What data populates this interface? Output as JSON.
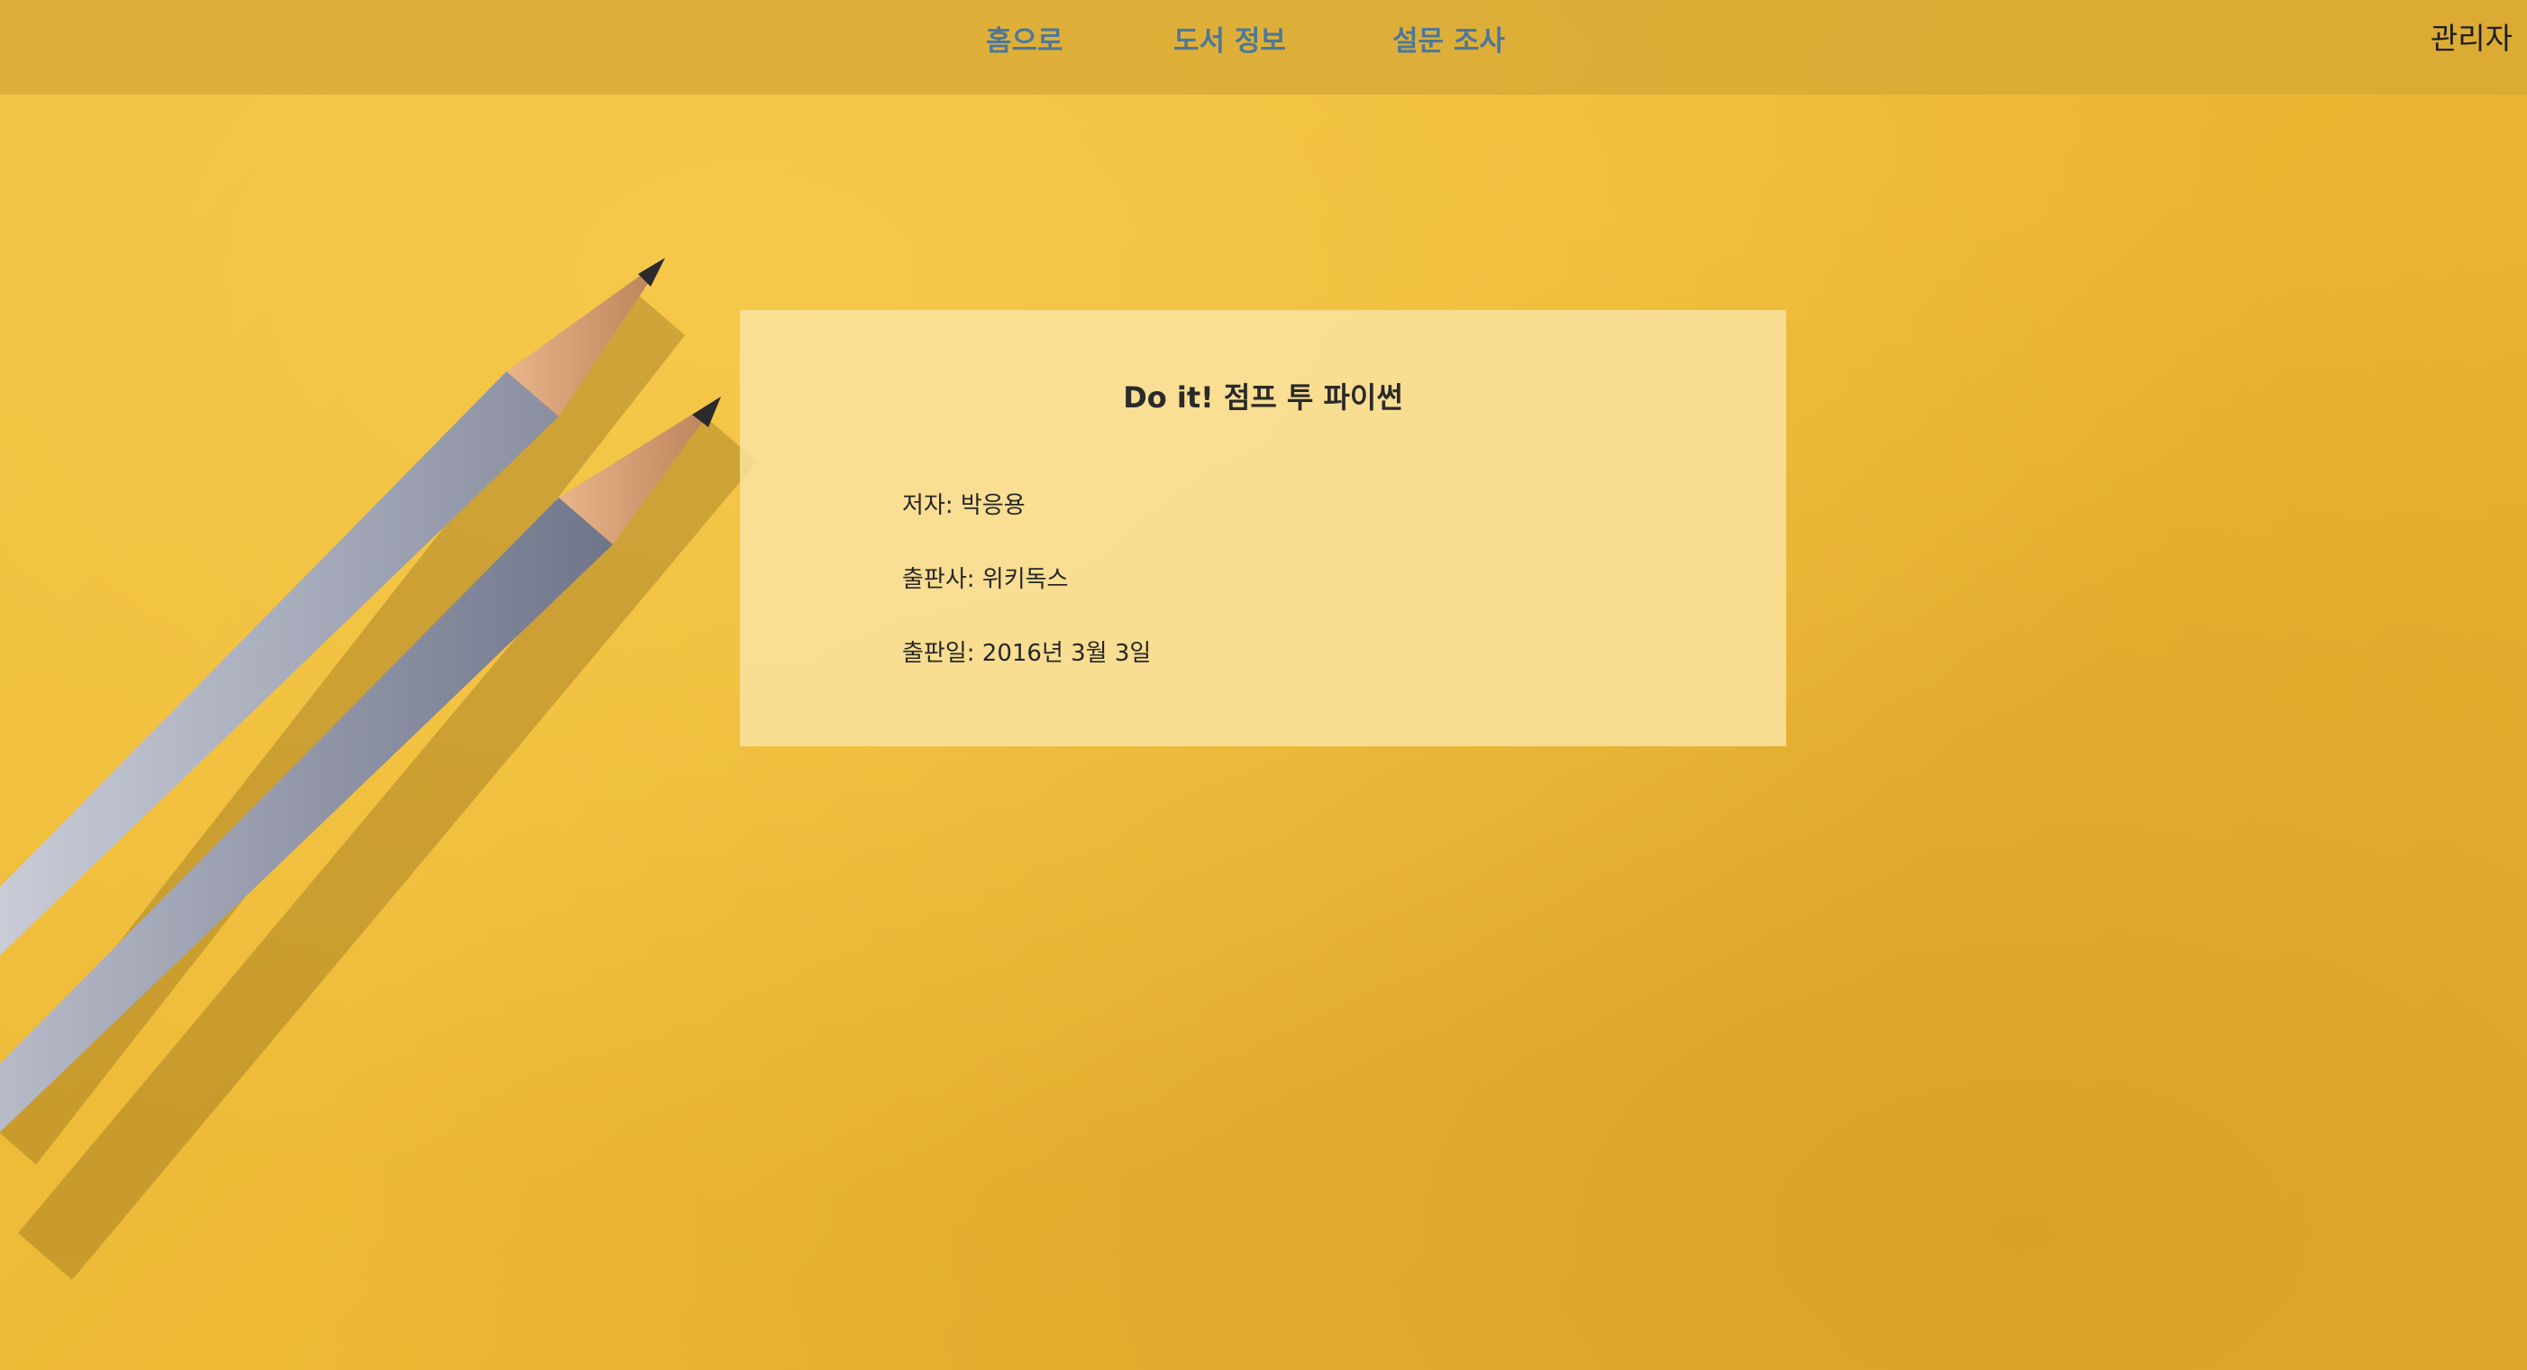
{
  "nav": {
    "home_label": "홈으로",
    "books_label": "도서 정보",
    "survey_label": "설문 조사",
    "admin_label": "관리자"
  },
  "book": {
    "title": "Do it! 점프 투 파이썬",
    "author_line": "저자: 박응용",
    "publisher_line": "출판사: 위키독스",
    "date_line": "출판일: 2016년 3월 3일"
  },
  "colors": {
    "nav_link": "#4e7898",
    "background": "#f0bd3a",
    "card": "#fae4a5"
  },
  "decor": {
    "background_image": "pencils-on-yellow-paper"
  }
}
